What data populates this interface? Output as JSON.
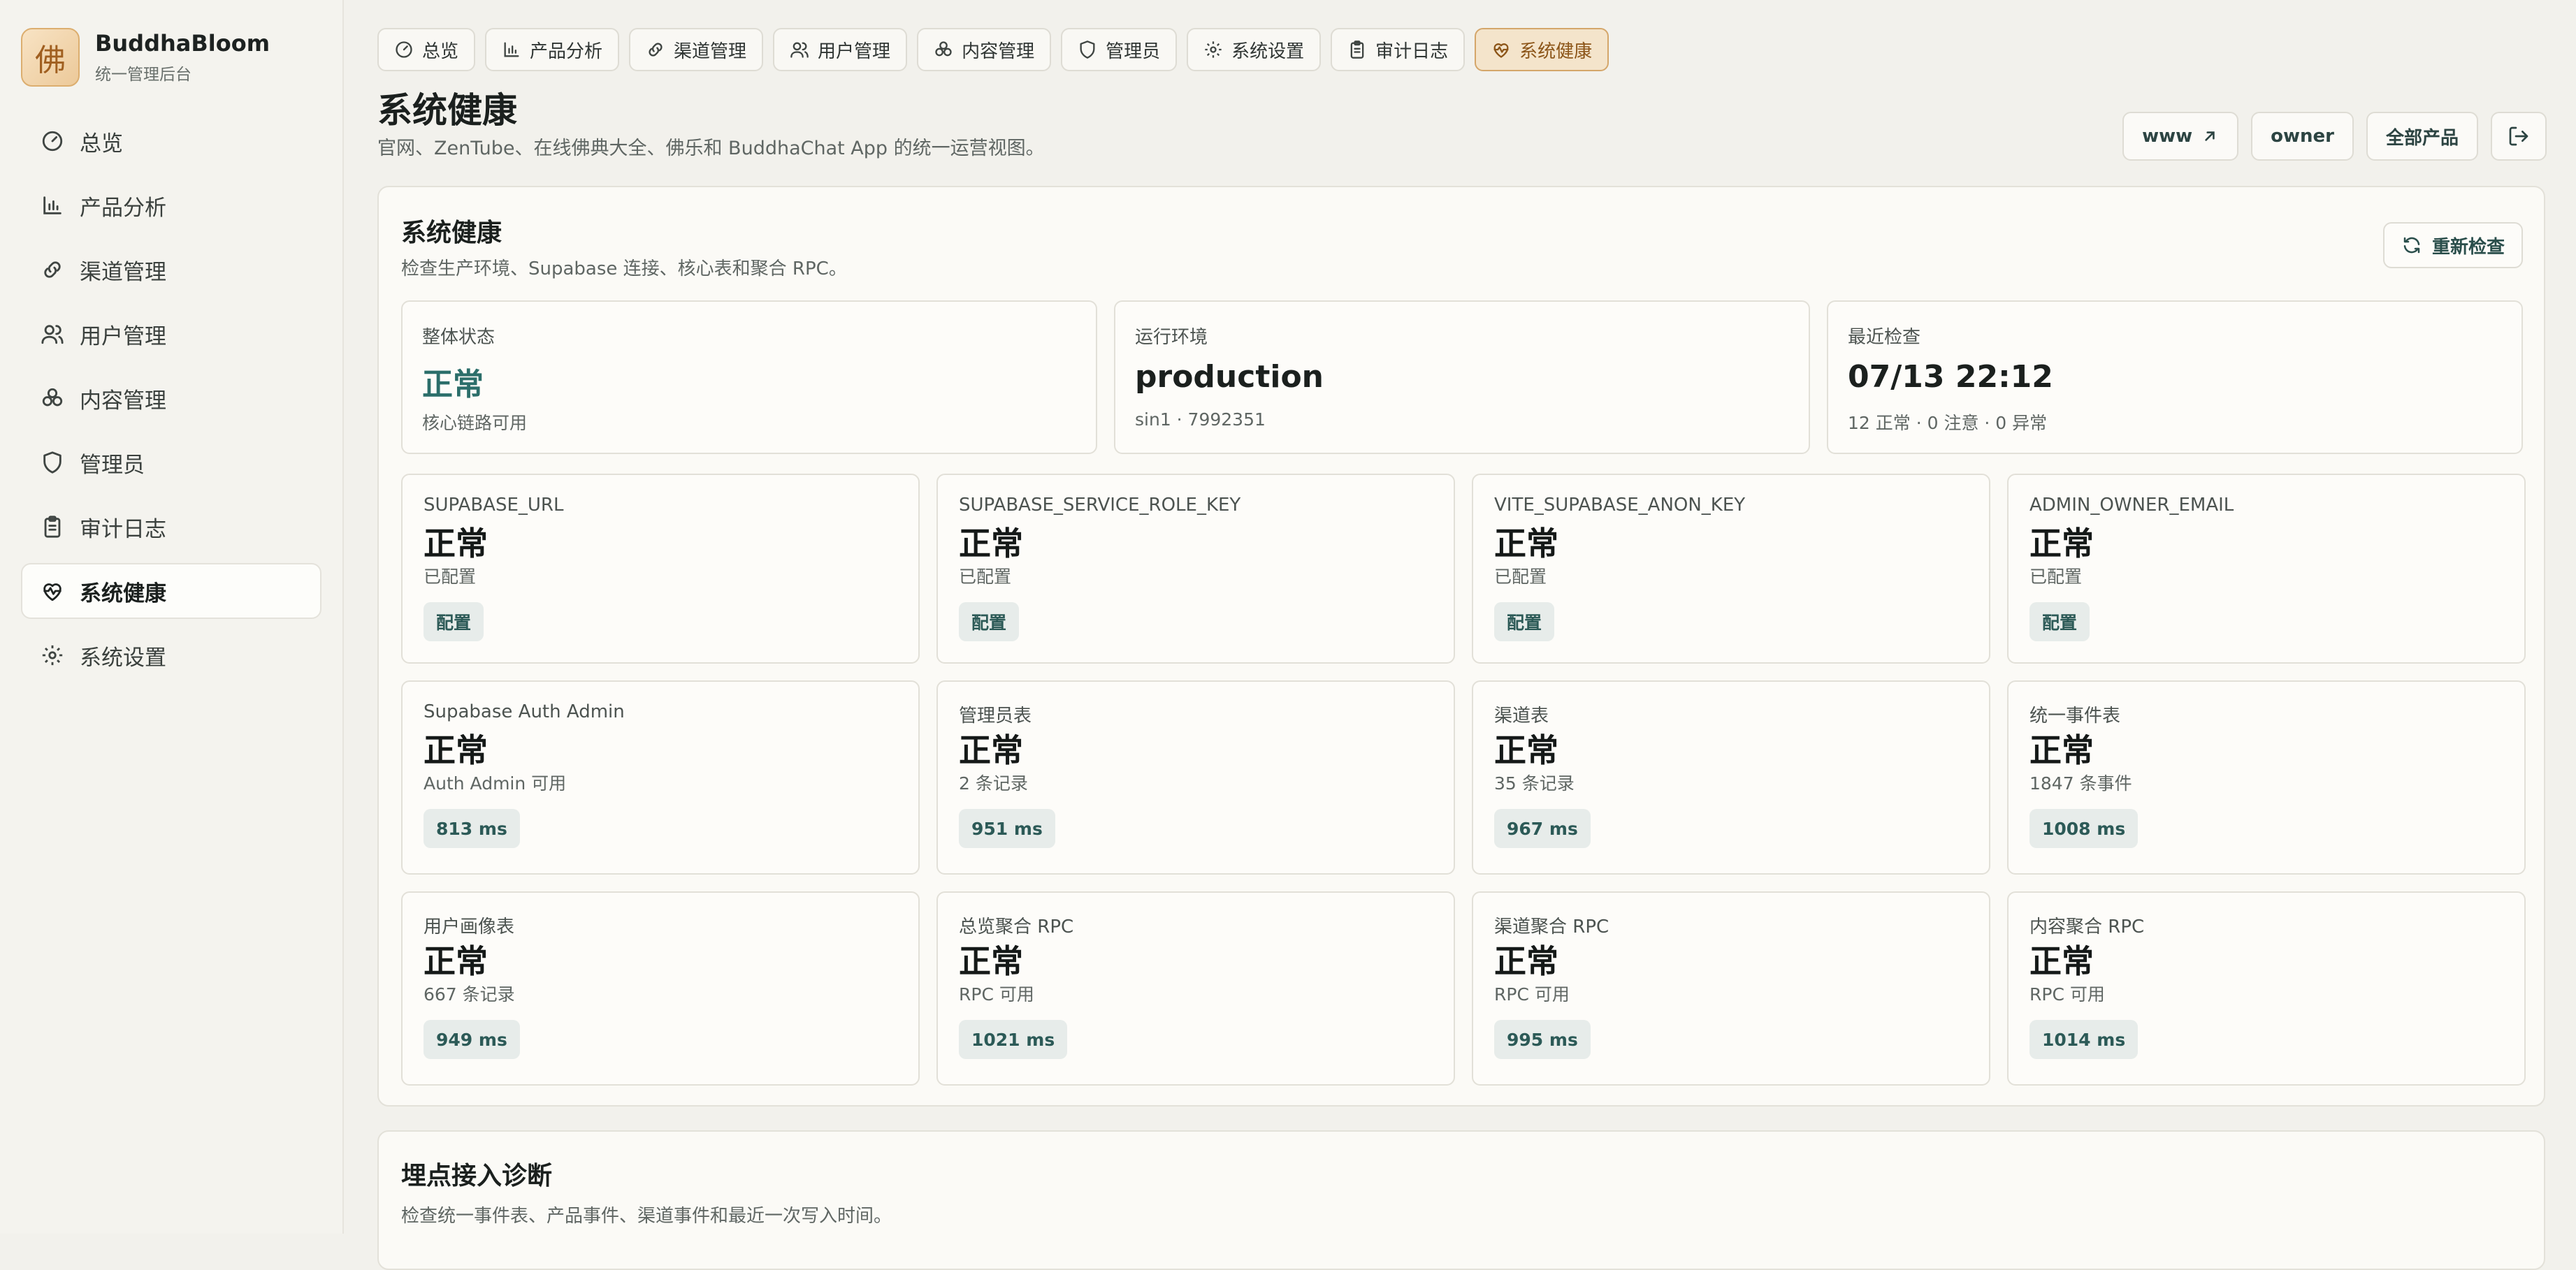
{
  "brand": {
    "logo_char": "佛",
    "name": "BuddhaBloom",
    "subtitle": "统一管理后台"
  },
  "sidebar": {
    "items": [
      {
        "label": "总览",
        "icon": "gauge-icon",
        "active": false
      },
      {
        "label": "产品分析",
        "icon": "bar-chart-icon",
        "active": false
      },
      {
        "label": "渠道管理",
        "icon": "link-icon",
        "active": false
      },
      {
        "label": "用户管理",
        "icon": "users-icon",
        "active": false
      },
      {
        "label": "内容管理",
        "icon": "layers-icon",
        "active": false
      },
      {
        "label": "管理员",
        "icon": "shield-icon",
        "active": false
      },
      {
        "label": "审计日志",
        "icon": "clipboard-icon",
        "active": false
      },
      {
        "label": "系统健康",
        "icon": "heart-pulse-icon",
        "active": true
      },
      {
        "label": "系统设置",
        "icon": "gear-icon",
        "active": false
      }
    ]
  },
  "tabs": [
    {
      "label": "总览",
      "icon": "gauge-icon"
    },
    {
      "label": "产品分析",
      "icon": "bar-chart-icon"
    },
    {
      "label": "渠道管理",
      "icon": "link-icon"
    },
    {
      "label": "用户管理",
      "icon": "users-icon"
    },
    {
      "label": "内容管理",
      "icon": "layers-icon"
    },
    {
      "label": "管理员",
      "icon": "shield-icon"
    },
    {
      "label": "系统设置",
      "icon": "gear-icon"
    },
    {
      "label": "审计日志",
      "icon": "clipboard-icon"
    },
    {
      "label": "系统健康",
      "icon": "heart-pulse-icon",
      "active": true
    }
  ],
  "header": {
    "title": "系统健康",
    "subtitle": "官网、ZenTube、在线佛典大全、佛乐和 BuddhaChat App 的统一运营视图。",
    "buttons": {
      "www": "www",
      "owner": "owner",
      "all_products": "全部产品"
    }
  },
  "health": {
    "title": "系统健康",
    "subtitle": "检查生产环境、Supabase 连接、核心表和聚合 RPC。",
    "recheck_label": "重新检查",
    "summary": {
      "overall": {
        "label": "整体状态",
        "value": "正常",
        "meta": "核心链路可用"
      },
      "env": {
        "label": "运行环境",
        "value": "production",
        "meta": "sin1 · 7992351"
      },
      "last": {
        "label": "最近检查",
        "value": "07/13 22:12",
        "meta": "12 正常 · 0 注意 · 0 异常"
      }
    },
    "checks": [
      {
        "name": "SUPABASE_URL",
        "status": "正常",
        "detail": "已配置",
        "badge": "配置"
      },
      {
        "name": "SUPABASE_SERVICE_ROLE_KEY",
        "status": "正常",
        "detail": "已配置",
        "badge": "配置"
      },
      {
        "name": "VITE_SUPABASE_ANON_KEY",
        "status": "正常",
        "detail": "已配置",
        "badge": "配置"
      },
      {
        "name": "ADMIN_OWNER_EMAIL",
        "status": "正常",
        "detail": "已配置",
        "badge": "配置"
      },
      {
        "name": "Supabase Auth Admin",
        "status": "正常",
        "detail": "Auth Admin 可用",
        "badge": "813 ms"
      },
      {
        "name": "管理员表",
        "status": "正常",
        "detail": "2 条记录",
        "badge": "951 ms"
      },
      {
        "name": "渠道表",
        "status": "正常",
        "detail": "35 条记录",
        "badge": "967 ms"
      },
      {
        "name": "统一事件表",
        "status": "正常",
        "detail": "1847 条事件",
        "badge": "1008 ms"
      },
      {
        "name": "用户画像表",
        "status": "正常",
        "detail": "667 条记录",
        "badge": "949 ms"
      },
      {
        "name": "总览聚合 RPC",
        "status": "正常",
        "detail": "RPC 可用",
        "badge": "1021 ms"
      },
      {
        "name": "渠道聚合 RPC",
        "status": "正常",
        "detail": "RPC 可用",
        "badge": "995 ms"
      },
      {
        "name": "内容聚合 RPC",
        "status": "正常",
        "detail": "RPC 可用",
        "badge": "1014 ms"
      }
    ]
  },
  "diagnostics": {
    "title": "埋点接入诊断",
    "subtitle": "检查统一事件表、产品事件、渠道事件和最近一次写入时间。"
  },
  "colors": {
    "accent": "#2b6e6a",
    "active_tab_bg": "#f4e4cb",
    "active_tab_border": "#d4a66a",
    "logo": "#a05f20"
  }
}
